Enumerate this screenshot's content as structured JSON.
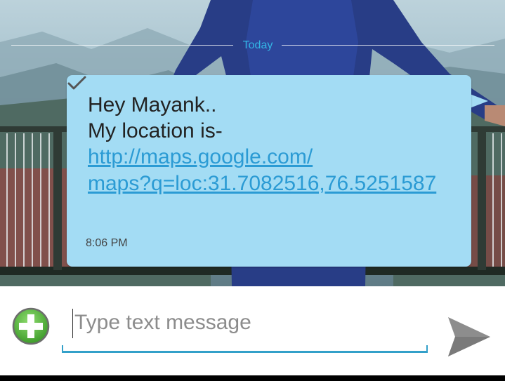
{
  "conversation": {
    "date_divider": "Today"
  },
  "message": {
    "line1": "Hey Mayank..",
    "line2": "My location is-",
    "link_line1": "http://maps.google.com/",
    "link_line2": "maps?q=loc:31.7082516,76.5251587",
    "time": "8:06 PM",
    "status_icon": "sent-check-icon"
  },
  "composer": {
    "placeholder": "Type text message",
    "value": "",
    "add_icon": "add-attachment-icon",
    "send_icon": "send-icon"
  },
  "colors": {
    "accent": "#33b5e5",
    "bubble": "#a3dcf4",
    "link": "#2b9bd4",
    "add_button": "#4caf3c"
  }
}
